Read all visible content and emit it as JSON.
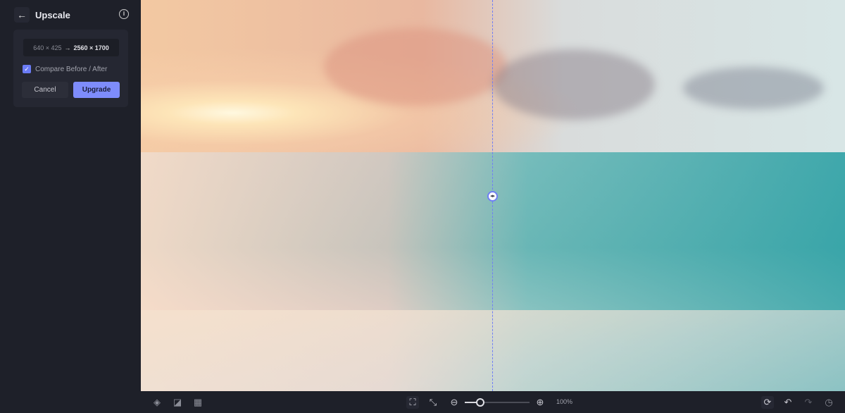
{
  "sidebar": {
    "title": "Upscale",
    "source_dims": "640 × 425",
    "target_dims": "2560 × 1700",
    "compare_label": "Compare Before / After",
    "compare_checked": true,
    "cancel_label": "Cancel",
    "upgrade_label": "Upgrade"
  },
  "toolbar": {
    "zoom_level": "100%",
    "zoom_slider_fraction": 0.24
  },
  "colors": {
    "accent": "#7e8cfb",
    "sidebar_bg": "#1e2029"
  }
}
